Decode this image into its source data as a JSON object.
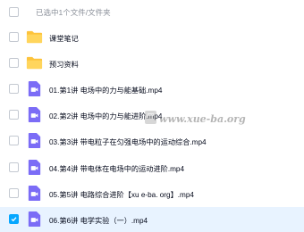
{
  "selection_text": "已选中1个文件/文件夹",
  "files": [
    {
      "type": "folder",
      "name": "课堂笔记",
      "checked": false
    },
    {
      "type": "folder",
      "name": "预习资料",
      "checked": false
    },
    {
      "type": "video",
      "name": "01.第1讲 电场中的力与能基础.mp4",
      "checked": false
    },
    {
      "type": "video",
      "name": "02.第2讲 电场中的力与能进阶.mp4",
      "checked": false
    },
    {
      "type": "video",
      "name": "03.第3讲 带电粒子在匀强电场中的运动综合.mp4",
      "checked": false
    },
    {
      "type": "video",
      "name": "04.第4讲 带电体在电场中的运动进阶.mp4",
      "checked": false
    },
    {
      "type": "video",
      "name": "05.第5讲 电路综合进阶【xu e-ba. org】.mp4",
      "checked": false
    },
    {
      "type": "video",
      "name": "06.第6讲 电学实验（一）.mp4",
      "checked": true
    }
  ],
  "watermark": "www.xue-ba.org",
  "colors": {
    "accent": "#06a7ff",
    "folder": "#fdc33b",
    "video": "#7b6cf6",
    "selected_row": "#e8f3ff"
  },
  "icons": {
    "folder": "folder-icon",
    "video": "video-file-icon",
    "check": "checkmark-icon"
  }
}
